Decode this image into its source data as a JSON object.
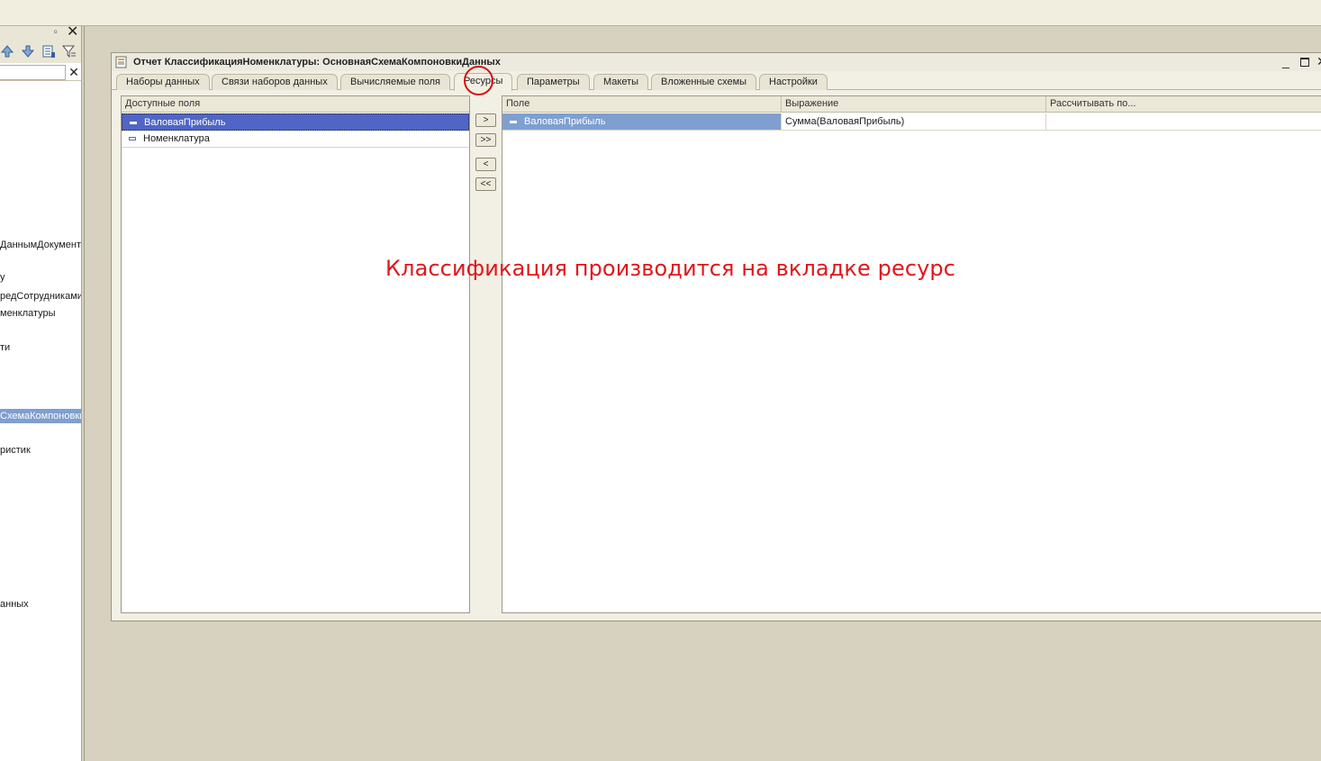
{
  "left_panel": {
    "search_value": "",
    "tree_items": [
      {
        "label": "ДаннымДокумента",
        "top": 0
      },
      {
        "label": "у",
        "top": 0
      },
      {
        "label": "редСотрудниками",
        "top": 0
      },
      {
        "label": "менклатуры",
        "top": 0
      },
      {
        "label": "ти",
        "top": 0
      },
      {
        "label": "СхемаКомпоновки",
        "top": 0
      },
      {
        "label": "ристик",
        "top": 0
      },
      {
        "label": "анных",
        "top": 0
      }
    ]
  },
  "window": {
    "title": "Отчет КлассификацияНоменклатуры: ОсновнаяСхемаКомпоновкиДанных",
    "tabs": [
      "Наборы данных",
      "Связи наборов данных",
      "Вычисляемые поля",
      "Ресурсы",
      "Параметры",
      "Макеты",
      "Вложенные схемы",
      "Настройки"
    ],
    "active_tab": "Ресурсы"
  },
  "available_fields": {
    "header": "Доступные поля",
    "items": [
      "ВаловаяПрибыль",
      "Номенклатура"
    ]
  },
  "move_buttons": {
    "add": ">",
    "add_all": ">>",
    "remove": "<",
    "remove_all": "<<"
  },
  "resources_table": {
    "columns": [
      "Поле",
      "Выражение",
      "Рассчитывать по..."
    ],
    "rows": [
      {
        "field": "ВаловаяПрибыль",
        "expression": "Сумма(ВаловаяПрибыль)",
        "calc_by": ""
      }
    ]
  },
  "annotation": "Классификация производится на вкладке ресурс",
  "colors": {
    "annotation": "#e0161b",
    "selection_dark": "#5065c6",
    "selection_light": "#7f9fd0"
  }
}
